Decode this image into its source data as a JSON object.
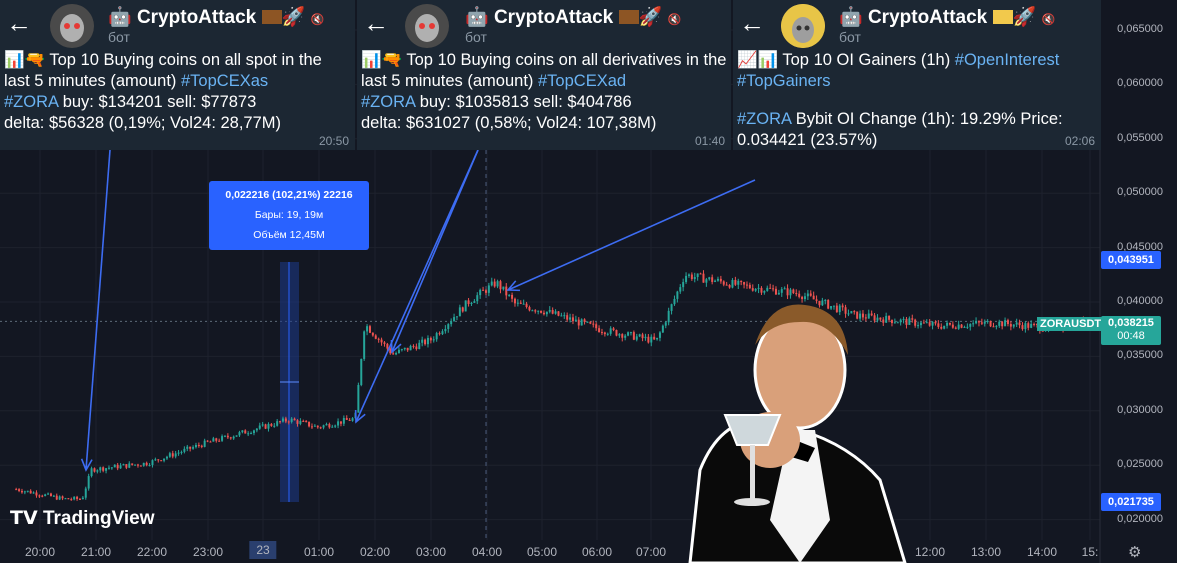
{
  "channel": {
    "name": "CryptoAttack",
    "subtitle": "бот",
    "post1": {
      "line_a": " Top 10 Buying coins on all spot in the last 5 minutes (amount) ",
      "tag_a": "#TopCEXas",
      "tag_b": "#ZORA",
      "line_b": " buy: $134201 sell: $77873",
      "line_c": "delta: $56328 (0,19%; Vol24: 28,77M)",
      "time": "20:50"
    },
    "post2": {
      "line_a": " Top 10 Buying coins on all derivatives in the last 5 minutes (amount) ",
      "tag_a": "#TopCEXad",
      "tag_b": "#ZORA",
      "line_b": " buy: $1035813 sell: $404786",
      "line_c": "delta: $631027 (0,58%; Vol24: 107,38M)",
      "time": "01:40"
    },
    "post3": {
      "line_a": " Top 10 OI Gainers (1h) ",
      "tag_a": "#OpenInterest",
      "tag_b": "#TopGainers",
      "tag_c": "#ZORA",
      "line_b": " Bybit OI Change (1h): 19.29% Price: 0.034421 (23.57%)",
      "time": "02:06"
    }
  },
  "overlay": {
    "measure_line1": "0,022216 (102,21%) 22216",
    "measure_line2": "Бары: 19, 19м",
    "measure_line3": "Объём 12,45M",
    "symbol_label": "ZORAUSDT",
    "current_price": "0,038215",
    "countdown": "00:48",
    "high_marker": "0,043951",
    "low_marker": "0,021735",
    "logo_text": "TradingView"
  },
  "colors": {
    "background": "#131722",
    "bull": "#26a69a",
    "bear": "#ef5350",
    "accent": "#2962ff"
  },
  "chart_data": {
    "type": "candlestick",
    "symbol": "ZORAUSDT",
    "y_ticks": [
      "0,065000",
      "0,060000",
      "0,055000",
      "0,050000",
      "0,045000",
      "0,040000",
      "0,035000",
      "0,030000",
      "0,025000",
      "0,020000"
    ],
    "x_ticks": [
      "20:00",
      "21:00",
      "22:00",
      "23:00",
      "23",
      "01:00",
      "02:00",
      "03:00",
      "04:00",
      "05:00",
      "06:00",
      "07:00",
      "12:00",
      "13:00",
      "14:00",
      "15:"
    ],
    "ylim": [
      0.0195,
      0.0665
    ],
    "grid": true,
    "price_path": [
      {
        "x": "19:40",
        "y": 0.0228
      },
      {
        "x": "20:30",
        "y": 0.0219
      },
      {
        "x": "20:50",
        "y": 0.0219
      },
      {
        "x": "21:00",
        "y": 0.0246
      },
      {
        "x": "22:00",
        "y": 0.0252
      },
      {
        "x": "23:00",
        "y": 0.027
      },
      {
        "x": "00:30",
        "y": 0.0292
      },
      {
        "x": "01:00",
        "y": 0.0285
      },
      {
        "x": "01:40",
        "y": 0.0293
      },
      {
        "x": "01:50",
        "y": 0.038
      },
      {
        "x": "02:20",
        "y": 0.0352
      },
      {
        "x": "03:00",
        "y": 0.0365
      },
      {
        "x": "03:40",
        "y": 0.04
      },
      {
        "x": "04:10",
        "y": 0.0418
      },
      {
        "x": "04:30",
        "y": 0.0398
      },
      {
        "x": "05:00",
        "y": 0.0392
      },
      {
        "x": "06:00",
        "y": 0.0375
      },
      {
        "x": "07:00",
        "y": 0.0364
      },
      {
        "x": "07:30",
        "y": 0.0425
      },
      {
        "x": "08:30",
        "y": 0.0415
      },
      {
        "x": "09:30",
        "y": 0.0408
      },
      {
        "x": "10:30",
        "y": 0.0388
      },
      {
        "x": "12:00",
        "y": 0.0378
      },
      {
        "x": "13:00",
        "y": 0.0381
      },
      {
        "x": "14:00",
        "y": 0.0376
      },
      {
        "x": "14:40",
        "y": 0.0382
      }
    ],
    "current_price": 0.038215,
    "measured_move": {
      "change": 0.022216,
      "percent": "102,21%",
      "bars": 19
    }
  }
}
